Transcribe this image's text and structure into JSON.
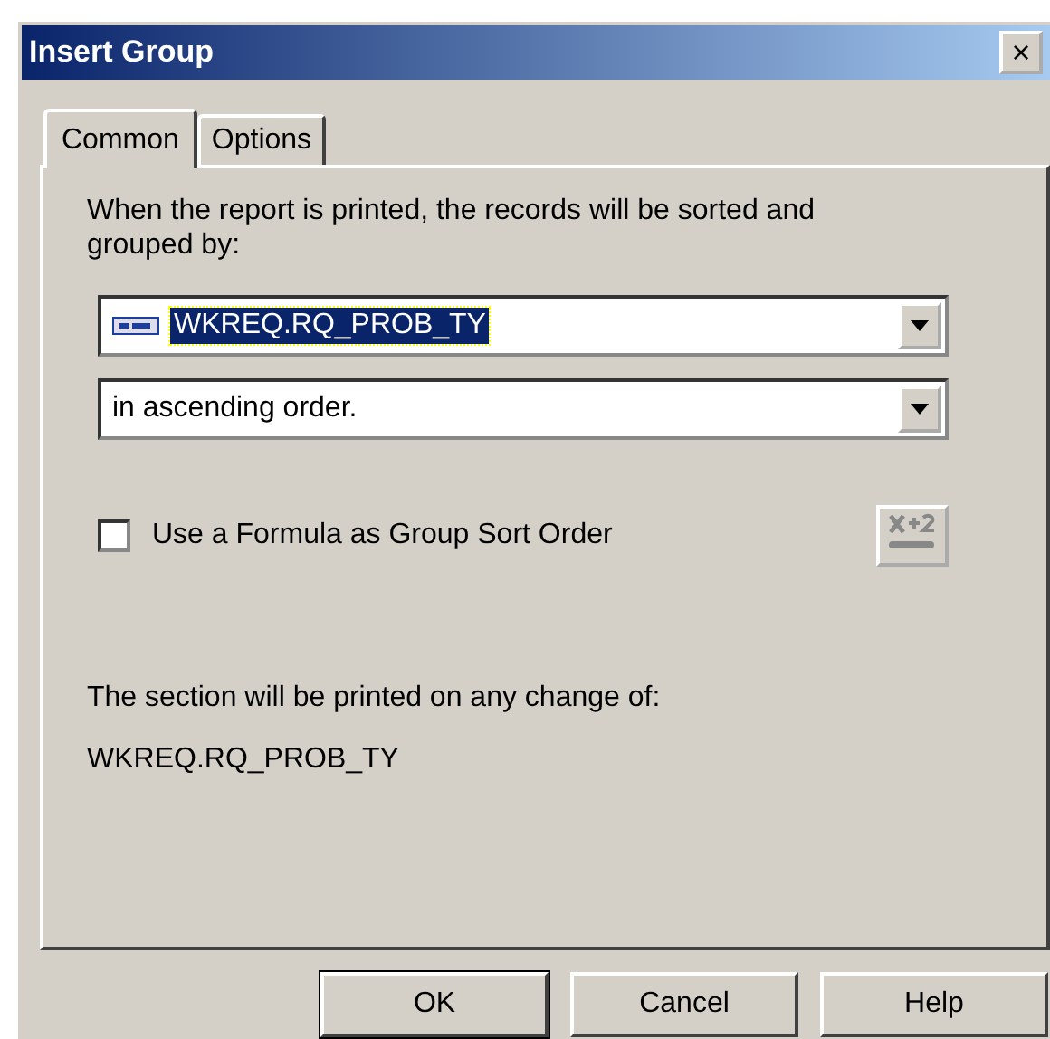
{
  "window": {
    "title": "Insert Group",
    "close": "×"
  },
  "tabs": [
    {
      "label": "Common",
      "selected": true
    },
    {
      "label": "Options",
      "selected": false
    }
  ],
  "instruction": "When the report is printed, the records will be sorted and grouped by:",
  "field_dropdown": {
    "value": "WKREQ.RQ_PROB_TY",
    "selected": true
  },
  "order_dropdown": {
    "value": "in ascending order."
  },
  "formula_checkbox": {
    "label": "Use a Formula as Group Sort Order",
    "checked": false
  },
  "summary_label": "The section will be printed on any change of:",
  "summary_value": "WKREQ.RQ_PROB_TY",
  "buttons": [
    {
      "label": "OK",
      "default": true
    },
    {
      "label": "Cancel",
      "default": false
    },
    {
      "label": "Help",
      "default": false
    }
  ]
}
